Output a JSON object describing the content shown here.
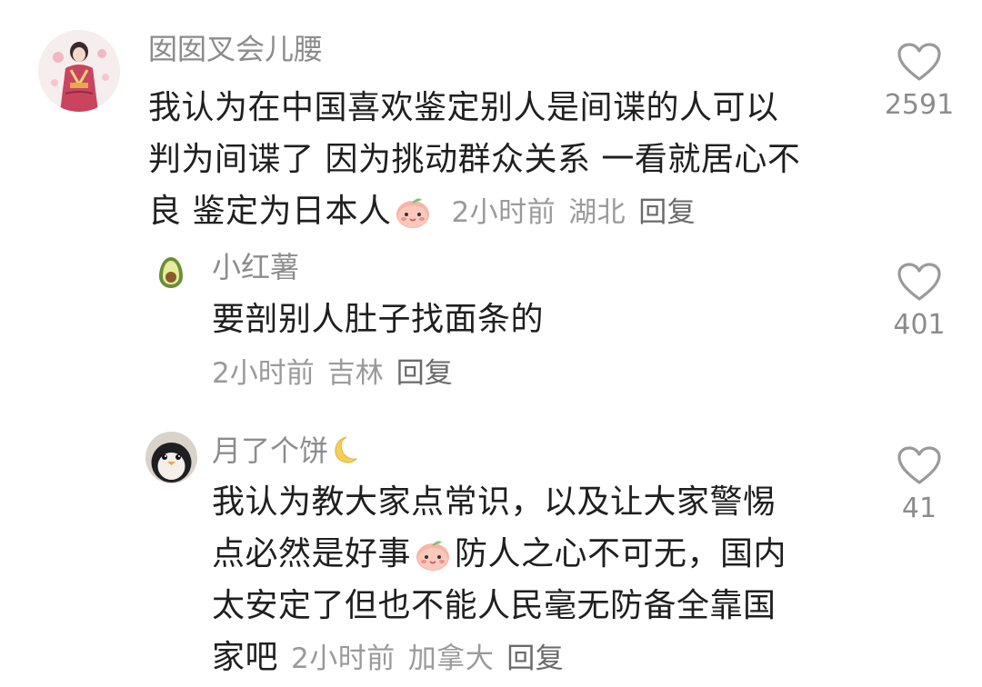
{
  "comments": [
    {
      "username": "囡囡叉会儿腰",
      "avatar": "kimono-girl-avatar",
      "text_part1": "我认为在中国喜欢鉴定别人是间谍的人可以",
      "text_part2": "判为间谍了 因为挑动群众关系 一看就居心不",
      "text_part3": "良 鉴定为日本人",
      "emoji": "peach-face-emoji",
      "time": "2小时前",
      "location": "湖北",
      "reply_label": "回复",
      "like_count": "2591"
    },
    {
      "username": "小红薯",
      "avatar": "avocado-avatar",
      "text": "要剖别人肚子找面条的",
      "time": "2小时前",
      "location": "吉林",
      "reply_label": "回复",
      "like_count": "401"
    },
    {
      "username": "月了个饼",
      "username_emoji": "crescent-moon-emoji",
      "avatar": "penguin-avatar",
      "text_part1": "我认为教大家点常识，以及让大家警惕",
      "text_part2a": "点必然是好事",
      "emoji": "peach-face-emoji",
      "text_part2b": "防人之心不可无，国内",
      "text_part3": "太安定了但也不能人民毫无防备全靠国",
      "text_part4": "家吧",
      "time": "2小时前",
      "location": "加拿大",
      "reply_label": "回复",
      "like_count": "41"
    }
  ],
  "colors": {
    "meta": "#9a9a9a",
    "username": "#8c8c8c",
    "text": "#1f1f1f",
    "heart_stroke": "#9a9a9a"
  }
}
